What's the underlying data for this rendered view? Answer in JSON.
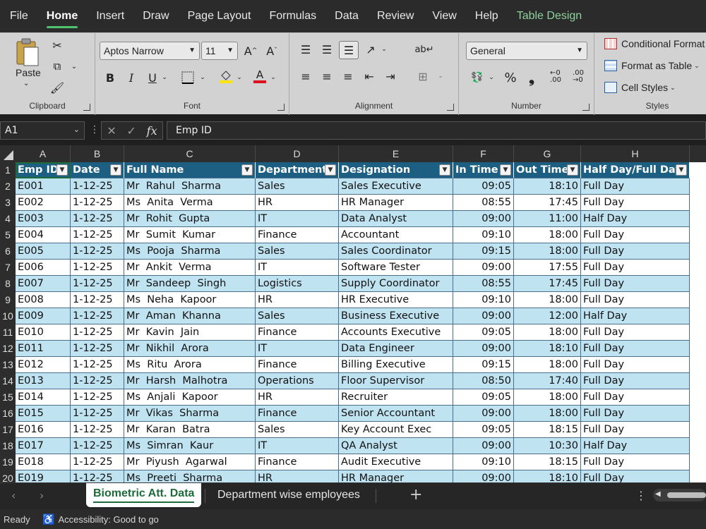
{
  "menu": {
    "tabs": [
      "File",
      "Home",
      "Insert",
      "Draw",
      "Page Layout",
      "Formulas",
      "Data",
      "Review",
      "View",
      "Help",
      "Table Design"
    ],
    "active": "Home"
  },
  "ribbon": {
    "clipboard": {
      "paste_label": "Paste",
      "group_label": "Clipboard"
    },
    "font": {
      "font_name": "Aptos Narrow",
      "font_size": "11",
      "group_label": "Font"
    },
    "alignment": {
      "group_label": "Alignment"
    },
    "number": {
      "format": "General",
      "group_label": "Number"
    },
    "styles": {
      "conditional": "Conditional Format",
      "format_table": "Format as Table",
      "cell_styles": "Cell Styles",
      "group_label": "Styles"
    }
  },
  "formula_bar": {
    "name_box": "A1",
    "content": "Emp ID"
  },
  "columns": [
    "A",
    "B",
    "C",
    "D",
    "E",
    "F",
    "G",
    "H"
  ],
  "rows": [
    "1",
    "2",
    "3",
    "4",
    "5",
    "6",
    "7",
    "8",
    "9",
    "10",
    "11",
    "12",
    "13",
    "14",
    "15",
    "16",
    "17",
    "18",
    "19",
    "20"
  ],
  "table": {
    "headers": [
      "Emp ID",
      "Date",
      "Full Name",
      "Department",
      "Designation",
      "In Time",
      "Out Time",
      "Half Day/Full Day"
    ],
    "data": [
      [
        "E001",
        "1-12-25",
        "Mr  Rahul  Sharma",
        "Sales",
        "Sales Executive",
        "09:05",
        "18:10",
        "Full Day"
      ],
      [
        "E002",
        "1-12-25",
        "Ms  Anita  Verma",
        "HR",
        "HR Manager",
        "08:55",
        "17:45",
        "Full Day"
      ],
      [
        "E003",
        "1-12-25",
        "Mr  Rohit  Gupta",
        "IT",
        "Data Analyst",
        "09:00",
        "11:00",
        "Half Day"
      ],
      [
        "E004",
        "1-12-25",
        "Mr  Sumit  Kumar",
        "Finance",
        "Accountant",
        "09:10",
        "18:00",
        "Full Day"
      ],
      [
        "E005",
        "1-12-25",
        "Ms  Pooja  Sharma",
        "Sales",
        "Sales Coordinator",
        "09:15",
        "18:00",
        "Full Day"
      ],
      [
        "E006",
        "1-12-25",
        "Mr  Ankit  Verma",
        "IT",
        "Software Tester",
        "09:00",
        "17:55",
        "Full Day"
      ],
      [
        "E007",
        "1-12-25",
        "Mr  Sandeep  Singh",
        "Logistics",
        "Supply Coordinator",
        "08:55",
        "17:45",
        "Full Day"
      ],
      [
        "E008",
        "1-12-25",
        "Ms  Neha  Kapoor",
        "HR",
        "HR Executive",
        "09:10",
        "18:00",
        "Full Day"
      ],
      [
        "E009",
        "1-12-25",
        "Mr  Aman  Khanna",
        "Sales",
        "Business Executive",
        "09:00",
        "12:00",
        "Half Day"
      ],
      [
        "E010",
        "1-12-25",
        "Mr  Kavin  Jain",
        "Finance",
        "Accounts Executive",
        "09:05",
        "18:00",
        "Full Day"
      ],
      [
        "E011",
        "1-12-25",
        "Mr  Nikhil  Arora",
        "IT",
        "Data Engineer",
        "09:00",
        "18:10",
        "Full Day"
      ],
      [
        "E012",
        "1-12-25",
        "Ms  Ritu  Arora",
        "Finance",
        "Billing Executive",
        "09:15",
        "18:00",
        "Full Day"
      ],
      [
        "E013",
        "1-12-25",
        "Mr  Harsh  Malhotra",
        "Operations",
        "Floor Supervisor",
        "08:50",
        "17:40",
        "Full Day"
      ],
      [
        "E014",
        "1-12-25",
        "Ms  Anjali  Kapoor",
        "HR",
        "Recruiter",
        "09:05",
        "18:00",
        "Full Day"
      ],
      [
        "E015",
        "1-12-25",
        "Mr  Vikas  Sharma",
        "Finance",
        "Senior Accountant",
        "09:00",
        "18:00",
        "Full Day"
      ],
      [
        "E016",
        "1-12-25",
        "Mr  Karan  Batra",
        "Sales",
        "Key Account Exec",
        "09:05",
        "18:15",
        "Full Day"
      ],
      [
        "E017",
        "1-12-25",
        "Ms  Simran  Kaur",
        "IT",
        "QA Analyst",
        "09:00",
        "10:30",
        "Half Day"
      ],
      [
        "E018",
        "1-12-25",
        "Mr  Piyush  Agarwal",
        "Finance",
        "Audit Executive",
        "09:10",
        "18:15",
        "Full Day"
      ],
      [
        "E019",
        "1-12-25",
        "Ms  Preeti  Sharma",
        "HR",
        "HR Manager",
        "09:00",
        "18:10",
        "Full Day"
      ]
    ]
  },
  "sheets": {
    "tabs": [
      "Biometric Att. Data",
      "Department wise employees"
    ],
    "active": "Biometric Att. Data"
  },
  "status": {
    "ready": "Ready",
    "accessibility": "Accessibility: Good to go"
  }
}
